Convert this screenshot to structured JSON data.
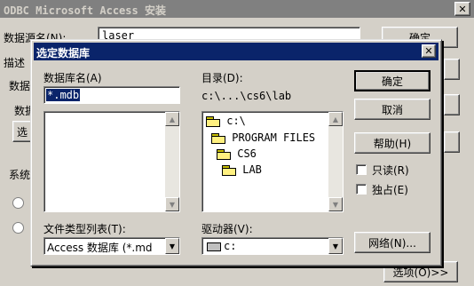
{
  "bg_dialog": {
    "title": "ODBC Microsoft Access 安装",
    "close_glyph": "✕",
    "data_source_label": "数据源名(N):",
    "data_source_value": "laser",
    "desc_label": "描述",
    "group1_label": "数据",
    "db_label_partial": "数据",
    "select_btn_partial": "选",
    "system_label": "系统",
    "ok_partial": "确定",
    "options_btn": "选项(O)>>"
  },
  "dialog": {
    "title": "选定数据库",
    "close_glyph": "✕",
    "db_name_label": "数据库名(A)",
    "db_name_value": "*.mdb",
    "dir_label": "目录(D):",
    "dir_path": "c:\\...\\cs6\\lab",
    "folders": [
      "c:\\",
      "PROGRAM FILES",
      "CS6",
      "LAB"
    ],
    "file_type_label": "文件类型列表(T):",
    "file_type_value": "Access 数据库 (*.md",
    "drive_label": "驱动器(V):",
    "drive_value": "c:",
    "ok_button": "确定",
    "cancel_button": "取消",
    "help_button": "帮助(H)",
    "readonly_label": "只读(R)",
    "exclusive_label": "独占(E)",
    "network_button": "网络(N)..."
  },
  "colors": {
    "title_active": "#0a246a",
    "title_inactive": "#808080",
    "face": "#d4d0c8"
  }
}
